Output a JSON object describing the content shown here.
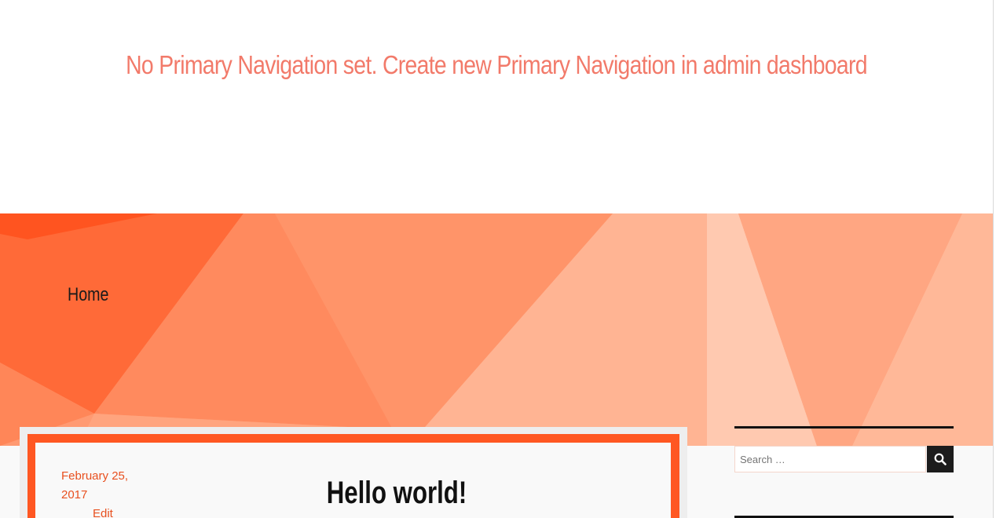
{
  "header": {
    "notice": "No Primary Navigation set. Create new Primary Navigation in admin dashboard"
  },
  "hero": {
    "nav_link": "Home"
  },
  "post": {
    "date": "February 25, 2017",
    "edit_label": "Edit",
    "title": "Hello world!"
  },
  "sidebar": {
    "search": {
      "placeholder": "Search …",
      "button_icon": "search-icon"
    }
  },
  "colors": {
    "accent": "#ff5722",
    "notice": "#f27a6a",
    "link": "#e8501f"
  }
}
